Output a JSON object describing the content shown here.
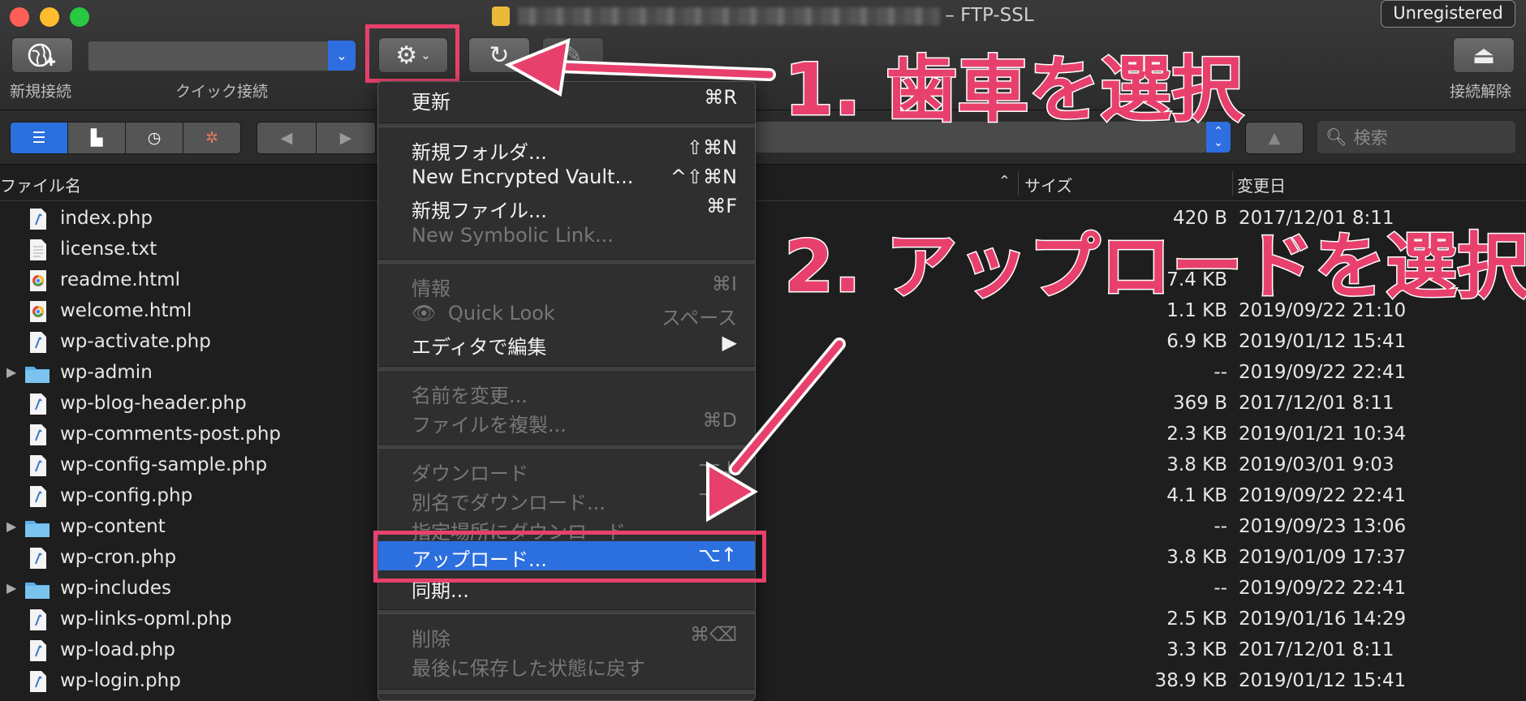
{
  "window": {
    "title_suffix": "– FTP-SSL",
    "unregistered": "Unregistered"
  },
  "toolbar": {
    "new_connection_label": "新規接続",
    "quick_connect_label": "クイック接続",
    "disconnect_label": "接続解除"
  },
  "search": {
    "placeholder": "検索"
  },
  "columns": {
    "name": "ファイル名",
    "size": "サイズ",
    "modified": "変更日"
  },
  "files": [
    {
      "name": "index.php",
      "size": "420 B",
      "date": "2017/12/01 8:11",
      "kind": "php"
    },
    {
      "name": "license.txt",
      "size": "",
      "date": "",
      "kind": "txt"
    },
    {
      "name": "readme.html",
      "size": "7.4 KB",
      "date": "",
      "kind": "html"
    },
    {
      "name": "welcome.html",
      "size": "1.1 KB",
      "date": "2019/09/22 21:10",
      "kind": "html"
    },
    {
      "name": "wp-activate.php",
      "size": "6.9 KB",
      "date": "2019/01/12 15:41",
      "kind": "php"
    },
    {
      "name": "wp-admin",
      "size": "--",
      "date": "2019/09/22 22:41",
      "kind": "folder"
    },
    {
      "name": "wp-blog-header.php",
      "size": "369 B",
      "date": "2017/12/01 8:11",
      "kind": "php"
    },
    {
      "name": "wp-comments-post.php",
      "size": "2.3 KB",
      "date": "2019/01/21 10:34",
      "kind": "php"
    },
    {
      "name": "wp-config-sample.php",
      "size": "3.8 KB",
      "date": "2019/03/01 9:03",
      "kind": "php"
    },
    {
      "name": "wp-config.php",
      "size": "4.1 KB",
      "date": "2019/09/22 22:41",
      "kind": "php"
    },
    {
      "name": "wp-content",
      "size": "--",
      "date": "2019/09/23 13:06",
      "kind": "folder"
    },
    {
      "name": "wp-cron.php",
      "size": "3.8 KB",
      "date": "2019/01/09 17:37",
      "kind": "php"
    },
    {
      "name": "wp-includes",
      "size": "--",
      "date": "2019/09/22 22:41",
      "kind": "folder"
    },
    {
      "name": "wp-links-opml.php",
      "size": "2.5 KB",
      "date": "2019/01/16 14:29",
      "kind": "php"
    },
    {
      "name": "wp-load.php",
      "size": "3.3 KB",
      "date": "2017/12/01 8:11",
      "kind": "php"
    },
    {
      "name": "wp-login.php",
      "size": "38.9 KB",
      "date": "2019/01/12 15:41",
      "kind": "php"
    }
  ],
  "menu": {
    "refresh": {
      "label": "更新",
      "shortcut": "⌘R"
    },
    "new_folder": {
      "label": "新規フォルダ...",
      "shortcut": "⇧⌘N"
    },
    "new_vault": {
      "label": "New Encrypted Vault...",
      "shortcut": "^⇧⌘N"
    },
    "new_file": {
      "label": "新規ファイル...",
      "shortcut": "⌘F"
    },
    "new_symlink": {
      "label": "New Symbolic Link...",
      "shortcut": ""
    },
    "info": {
      "label": "情報",
      "shortcut": "⌘I"
    },
    "quick_look": {
      "label": "Quick Look",
      "shortcut": "スペース"
    },
    "edit_with": {
      "label": "エディタで編集",
      "shortcut": "▶"
    },
    "rename": {
      "label": "名前を変更...",
      "shortcut": ""
    },
    "duplicate": {
      "label": "ファイルを複製...",
      "shortcut": "⌘D"
    },
    "download": {
      "label": "ダウンロード",
      "shortcut": "⌥↓"
    },
    "download_as": {
      "label": "別名でダウンロード...",
      "shortcut": "⌥⇧"
    },
    "download_to": {
      "label": "指定場所にダウンロード",
      "shortcut": ""
    },
    "upload": {
      "label": "アップロード...",
      "shortcut": "⌥↑"
    },
    "sync": {
      "label": "同期...",
      "shortcut": ""
    },
    "delete": {
      "label": "削除",
      "shortcut": "⌘⌫"
    },
    "revert": {
      "label": "最後に保存した状態に戻す",
      "shortcut": ""
    }
  },
  "annotations": {
    "step1": "1. 歯車を選択",
    "step2": "2. アップロードを選択"
  },
  "colors": {
    "accent": "#2c6fde",
    "annotation": "#e8406c"
  }
}
